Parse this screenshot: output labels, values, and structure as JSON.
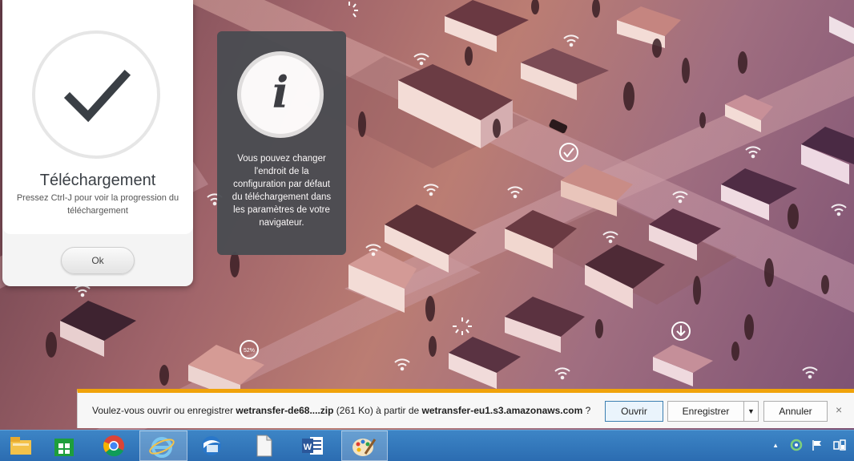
{
  "dialog": {
    "icon": "checkmark-icon",
    "title": "Téléchargement",
    "message": "Pressez Ctrl-J pour voir la progression du téléchargement",
    "ok_label": "Ok"
  },
  "info_panel": {
    "icon": "info-icon",
    "glyph": "i",
    "text": "Vous pouvez changer l'endroit de la configuration par défaut du téléchargement dans les paramètres de votre navigateur."
  },
  "background": {
    "progress_badge": "52%"
  },
  "notification_bar": {
    "prefix": "Voulez-vous ouvrir ou enregistrer ",
    "filename": "wetransfer-de68....zip",
    "size": " (261 Ko) à partir de ",
    "host": "wetransfer-eu1.s3.amazonaws.com",
    "suffix": " ?",
    "open_label": "Ouvrir",
    "save_label": "Enregistrer",
    "save_menu_glyph": "▼",
    "cancel_label": "Annuler",
    "close_glyph": "×"
  },
  "taskbar": {
    "items": [
      {
        "name": "file-explorer-icon"
      },
      {
        "name": "store-icon"
      },
      {
        "name": "chrome-icon"
      },
      {
        "name": "internet-explorer-icon",
        "active": true
      },
      {
        "name": "thunderbird-icon"
      },
      {
        "name": "blank-document-icon"
      },
      {
        "name": "word-icon"
      },
      {
        "name": "paint-icon",
        "active": true
      }
    ],
    "tray": {
      "overflow_glyph": "▲",
      "icons": [
        "sync-icon",
        "action-center-flag-icon",
        "network-icon"
      ]
    }
  },
  "colors": {
    "accent_orange": "#f0a30a",
    "taskbar_blue": "#2b6cb1",
    "panel_dark": "#4a4c52"
  }
}
